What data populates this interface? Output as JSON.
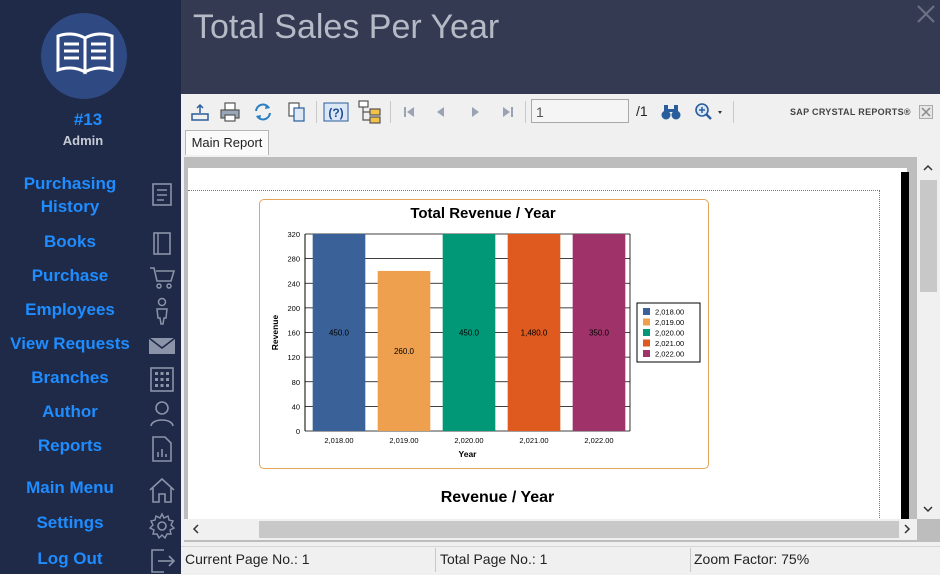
{
  "sidebar": {
    "user_number": "#13",
    "user_role": "Admin",
    "items": [
      {
        "label": "Purchasing History",
        "icon": "receipt-icon"
      },
      {
        "label": "Books",
        "icon": "book-icon"
      },
      {
        "label": "Purchase",
        "icon": "cart-icon"
      },
      {
        "label": "Employees",
        "icon": "person-icon"
      },
      {
        "label": "View Requests",
        "icon": "envelope-icon"
      },
      {
        "label": "Branches",
        "icon": "building-icon"
      },
      {
        "label": "Author",
        "icon": "user-icon"
      },
      {
        "label": "Reports",
        "icon": "report-icon"
      },
      {
        "label": "Main Menu",
        "icon": "home-icon"
      },
      {
        "label": "Settings",
        "icon": "gear-icon"
      },
      {
        "label": "Log Out",
        "icon": "logout-icon"
      }
    ]
  },
  "header": {
    "title": "Total Sales Per Year"
  },
  "toolbar": {
    "page_value": "1",
    "page_total": "/1",
    "brand": "SAP CRYSTAL REPORTS®"
  },
  "tabs": {
    "main": "Main Report"
  },
  "report": {
    "section_title": "Revenue / Year"
  },
  "status": {
    "current_page": "Current Page No.: 1",
    "total_page": "Total Page No.: 1",
    "zoom": "Zoom Factor: 75%"
  },
  "colors": {
    "sidebar_bg": "#1e2a48",
    "nav_text": "#1f8cff",
    "header_bg": "#343a52"
  },
  "chart_data": {
    "type": "bar",
    "title": "Total Revenue / Year",
    "xlabel": "Year",
    "ylabel": "Revenue",
    "ylim": [
      0,
      320
    ],
    "yticks": [
      "0",
      "40",
      "80",
      "120",
      "160",
      "200",
      "240",
      "280",
      "320"
    ],
    "categories": [
      "2,018.00",
      "2,019.00",
      "2,020.00",
      "2,021.00",
      "2,022.00"
    ],
    "values": [
      450,
      260,
      450,
      1480,
      350
    ],
    "value_labels": [
      "450.0",
      "260.0",
      "450.0",
      "1,480.0",
      "350.0"
    ],
    "colors": [
      "#3a6299",
      "#eea04f",
      "#009877",
      "#de5a1f",
      "#a0326a"
    ],
    "legend": [
      "2,018.00",
      "2,019.00",
      "2,020.00",
      "2,021.00",
      "2,022.00"
    ],
    "legend_position": "right",
    "grid": true
  }
}
